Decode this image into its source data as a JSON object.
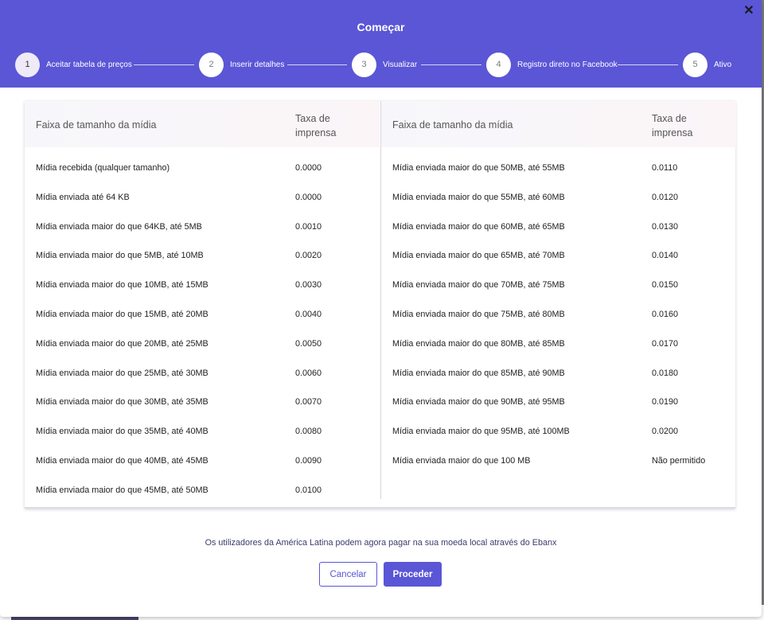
{
  "dialog": {
    "title": "Começar",
    "close_symbol": "✕",
    "close_icon": "close-icon"
  },
  "steps": [
    {
      "number": "1",
      "label": "Aceitar tabela de preços",
      "active": true
    },
    {
      "number": "2",
      "label": "Inserir detalhes",
      "active": false
    },
    {
      "number": "3",
      "label": "Visualizar",
      "active": false
    },
    {
      "number": "4",
      "label": "Registro direto no Facebook",
      "active": false
    },
    {
      "number": "5",
      "label": "Ativo",
      "active": false
    }
  ],
  "table": {
    "headers": {
      "range": "Faixa de tamanho da mídia",
      "rate_line1": "Taxa de",
      "rate_line2": "imprensa"
    },
    "left_rows": [
      {
        "range": "Mídia recebida (qualquer tamanho)",
        "rate": "0.0000"
      },
      {
        "range": "Mídia enviada até 64 KB",
        "rate": "0.0000"
      },
      {
        "range": "Mídia enviada maior do que 64KB, até 5MB",
        "rate": "0.0010"
      },
      {
        "range": "Mídia enviada maior do que 5MB, até 10MB",
        "rate": "0.0020"
      },
      {
        "range": "Mídia enviada maior do que 10MB, até 15MB",
        "rate": "0.0030"
      },
      {
        "range": "Mídia enviada maior do que 15MB, até 20MB",
        "rate": "0.0040"
      },
      {
        "range": "Mídia enviada maior do que 20MB, até 25MB",
        "rate": "0.0050"
      },
      {
        "range": "Mídia enviada maior do que 25MB, até 30MB",
        "rate": "0.0060"
      },
      {
        "range": "Mídia enviada maior do que 30MB, até 35MB",
        "rate": "0.0070"
      },
      {
        "range": "Mídia enviada maior do que 35MB, até 40MB",
        "rate": "0.0080"
      },
      {
        "range": "Mídia enviada maior do que 40MB, até 45MB",
        "rate": "0.0090"
      },
      {
        "range": "Mídia enviada maior do que 45MB, até 50MB",
        "rate": "0.0100"
      }
    ],
    "right_rows": [
      {
        "range": "Mídia enviada maior do que 50MB, até 55MB",
        "rate": "0.0110"
      },
      {
        "range": "Mídia enviada maior do que 55MB, até 60MB",
        "rate": "0.0120"
      },
      {
        "range": "Mídia enviada maior do que 60MB, até 65MB",
        "rate": "0.0130"
      },
      {
        "range": "Mídia enviada maior do que 65MB, até 70MB",
        "rate": "0.0140"
      },
      {
        "range": "Mídia enviada maior do que 70MB, até 75MB",
        "rate": "0.0150"
      },
      {
        "range": "Mídia enviada maior do que 75MB, até 80MB",
        "rate": "0.0160"
      },
      {
        "range": "Mídia enviada maior do que 80MB, até 85MB",
        "rate": "0.0170"
      },
      {
        "range": "Mídia enviada maior do que 85MB, até 90MB",
        "rate": "0.0180"
      },
      {
        "range": "Mídia enviada maior do que 90MB, até 95MB",
        "rate": "0.0190"
      },
      {
        "range": "Mídia enviada maior do que 95MB, até 100MB",
        "rate": "0.0200"
      },
      {
        "range": "Mídia enviada maior do que 100 MB",
        "rate": "Não permitido"
      }
    ]
  },
  "notice": "Os utilizadores da América Latina podem agora pagar na sua moeda local através do Ebanx",
  "buttons": {
    "cancel": "Cancelar",
    "proceed": "Proceder"
  },
  "colors": {
    "accent": "#5a56d6",
    "header_bg": "#5a56d6"
  }
}
